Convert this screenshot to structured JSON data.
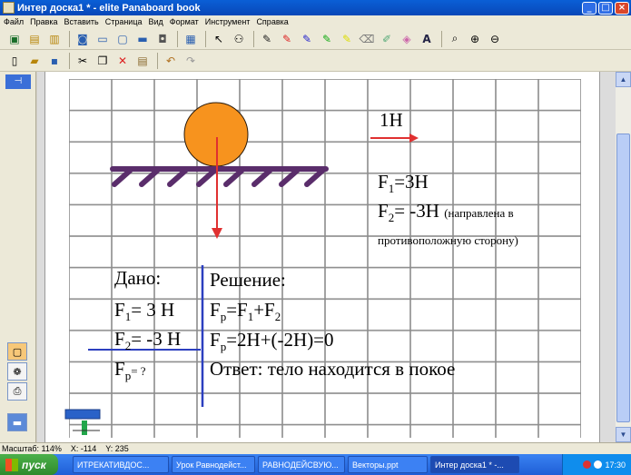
{
  "window": {
    "title": "Интер доска1 * - elite Panaboard book",
    "buttons": {
      "minimize": "_",
      "maximize": "□",
      "close": "×"
    }
  },
  "menu": [
    "Файл",
    "Правка",
    "Вставить",
    "Страница",
    "Вид",
    "Формат",
    "Инструмент",
    "Справка"
  ],
  "board": {
    "force_label": "1Н",
    "f1_line": {
      "prefix": "F",
      "sub": "1",
      "rest": "=3Н"
    },
    "f2_line": {
      "prefix": "F",
      "sub": "2",
      "rest": "= -3Н",
      "note": "(направлена в противоположную сторону)"
    },
    "given_title": "Дано:",
    "given_f1": {
      "prefix": "F",
      "sub": "1",
      "rest": "= 3 Н"
    },
    "given_f2": {
      "prefix": "F",
      "sub": "2",
      "rest": "= -3 Н"
    },
    "given_fp": {
      "prefix": "F",
      "sub": "р",
      "rest": "= ?"
    },
    "solution_title": "Решение:",
    "sol_line1": {
      "prefix": "F",
      "sub": "р",
      "mid": "=F",
      "sub2": "1",
      "mid2": "+F",
      "sub3": "2"
    },
    "sol_line2": {
      "prefix": "F",
      "sub": "р",
      "rest": "=2Н+(-2Н)=0"
    },
    "answer": "Ответ: тело находится в покое"
  },
  "status": {
    "zoom": "Масштаб: 114%",
    "x": "X: -114",
    "y": "Y: 235"
  },
  "taskbar": {
    "start": "пуск",
    "items": [
      "ИТРЕКАТИВДОС...",
      "Урок Равнодейст...",
      "РАВНОДЕЙСВУЮ...",
      "Векторы.ppt",
      "Интер доска1 * -..."
    ],
    "clock": "17:30"
  },
  "colors": {
    "ball": "#f7931e",
    "surface": "#5a2d6b",
    "arrow": "#e03030",
    "divider": "#2c3fbf"
  }
}
